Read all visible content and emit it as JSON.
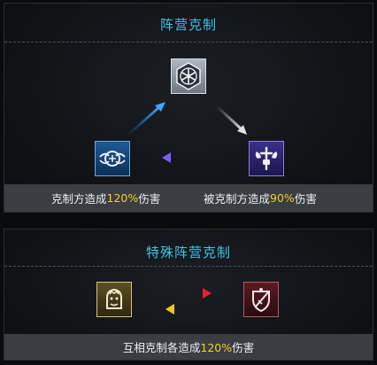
{
  "faction_counter": {
    "title": "阵营克制",
    "icons": {
      "top": "snowflake-hex-icon",
      "left": "winged-ring-icon",
      "right": "fist-cross-icon"
    },
    "info": {
      "left_prefix": "克制方造成",
      "left_value": "120%",
      "left_suffix": "伤害",
      "right_prefix": "被克制方造成",
      "right_value": "90%",
      "right_suffix": "伤害"
    }
  },
  "special_counter": {
    "title": "特殊阵营克制",
    "icons": {
      "left": "lion-emblem-icon",
      "right": "shield-sword-icon"
    },
    "info": {
      "prefix": "互相克制各造成",
      "value": "120%",
      "suffix": "伤害"
    }
  },
  "colors": {
    "title": "#3fc3ea",
    "highlight": "#f2cf2b",
    "arrow_blue": "#2f8fe0",
    "arrow_gray": "#c8c8c8",
    "arrow_purple": "#6a4fe0",
    "arrow_red": "#c8202a",
    "arrow_yellow": "#e2b51e"
  }
}
